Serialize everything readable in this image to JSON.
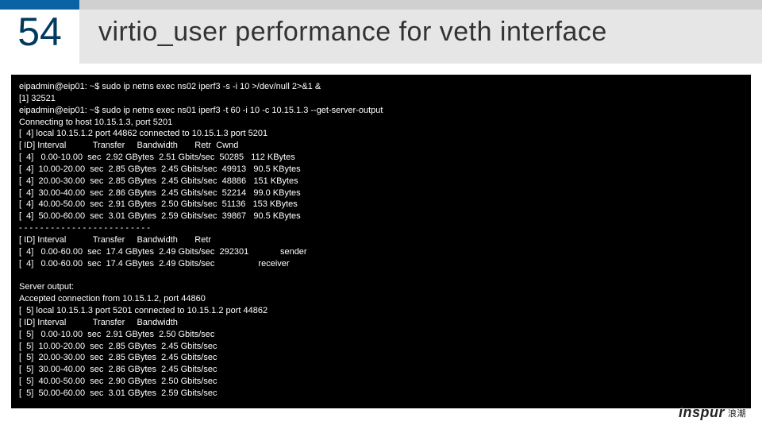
{
  "slide_number": "54",
  "title": "virtio_user performance for veth interface",
  "terminal_lines": [
    "eipadmin@eip01: ~$ sudo ip netns exec ns02 iperf3 -s -i 10 >/dev/null 2>&1 &",
    "[1] 32521",
    "eipadmin@eip01: ~$ sudo ip netns exec ns01 iperf3 -t 60 -i 10 -c 10.15.1.3 --get-server-output",
    "Connecting to host 10.15.1.3, port 5201",
    "[  4] local 10.15.1.2 port 44862 connected to 10.15.1.3 port 5201",
    "[ ID] Interval           Transfer     Bandwidth       Retr  Cwnd",
    "[  4]   0.00-10.00  sec  2.92 GBytes  2.51 Gbits/sec  50285   112 KBytes",
    "[  4]  10.00-20.00  sec  2.85 GBytes  2.45 Gbits/sec  49913   90.5 KBytes",
    "[  4]  20.00-30.00  sec  2.85 GBytes  2.45 Gbits/sec  48886   151 KBytes",
    "[  4]  30.00-40.00  sec  2.86 GBytes  2.45 Gbits/sec  52214   99.0 KBytes",
    "[  4]  40.00-50.00  sec  2.91 GBytes  2.50 Gbits/sec  51136   153 KBytes",
    "[  4]  50.00-60.00  sec  3.01 GBytes  2.59 Gbits/sec  39867   90.5 KBytes",
    "- - - - - - - - - - - - - - - - - - - - - - - - -",
    "[ ID] Interval           Transfer     Bandwidth       Retr",
    "[  4]   0.00-60.00  sec  17.4 GBytes  2.49 Gbits/sec  292301             sender",
    "[  4]   0.00-60.00  sec  17.4 GBytes  2.49 Gbits/sec                  receiver",
    "",
    "Server output:",
    "Accepted connection from 10.15.1.2, port 44860",
    "[  5] local 10.15.1.3 port 5201 connected to 10.15.1.2 port 44862",
    "[ ID] Interval           Transfer     Bandwidth",
    "[  5]   0.00-10.00  sec  2.91 GBytes  2.50 Gbits/sec",
    "[  5]  10.00-20.00  sec  2.85 GBytes  2.45 Gbits/sec",
    "[  5]  20.00-30.00  sec  2.85 GBytes  2.45 Gbits/sec",
    "[  5]  30.00-40.00  sec  2.86 GBytes  2.45 Gbits/sec",
    "[  5]  40.00-50.00  sec  2.90 GBytes  2.50 Gbits/sec",
    "[  5]  50.00-60.00  sec  3.01 GBytes  2.59 Gbits/sec"
  ],
  "footer": {
    "logo_text": "inspur",
    "logo_cn": "浪潮"
  }
}
